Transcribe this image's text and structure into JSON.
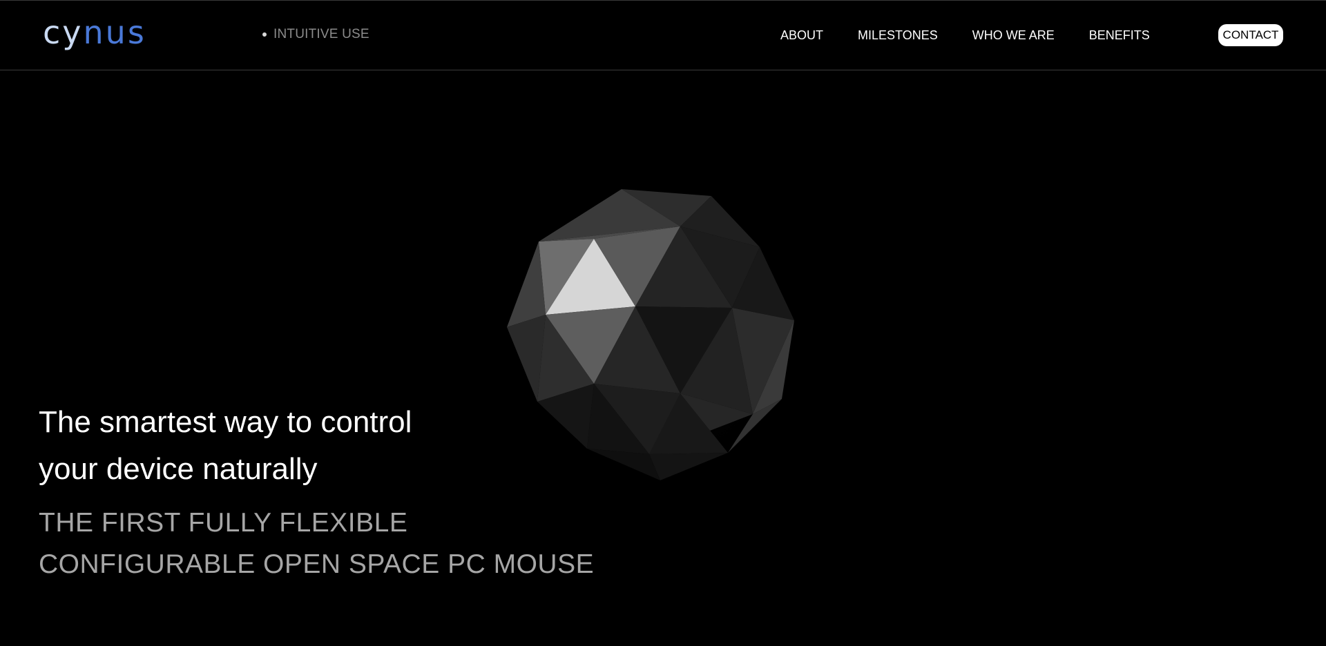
{
  "brand": {
    "logo_part_a": "cy",
    "logo_part_b": "nus",
    "logo_colors": {
      "part_a": "#c9d9f2",
      "part_b": "#4a79d8"
    }
  },
  "indicator": {
    "label": "INTUITIVE USE"
  },
  "nav": {
    "items": [
      {
        "label": "ABOUT"
      },
      {
        "label": "MILESTONES"
      },
      {
        "label": "WHO WE ARE"
      },
      {
        "label": "BENEFITS"
      }
    ],
    "contact_label": "CONTACT"
  },
  "hero": {
    "title_line_1": "The smartest way to control",
    "title_line_2": "your device naturally",
    "subtitle_line_1": "THE FIRST FULLY FLEXIBLE",
    "subtitle_line_2": "CONFIGURABLE OPEN SPACE PC MOUSE",
    "object_icon": "icosphere-3d-icon"
  },
  "colors": {
    "background": "#000000",
    "text_primary": "#ffffff",
    "text_muted": "#a6a6a6",
    "nav_indicator": "#8c8c8c",
    "contact_bg": "#ffffff"
  }
}
